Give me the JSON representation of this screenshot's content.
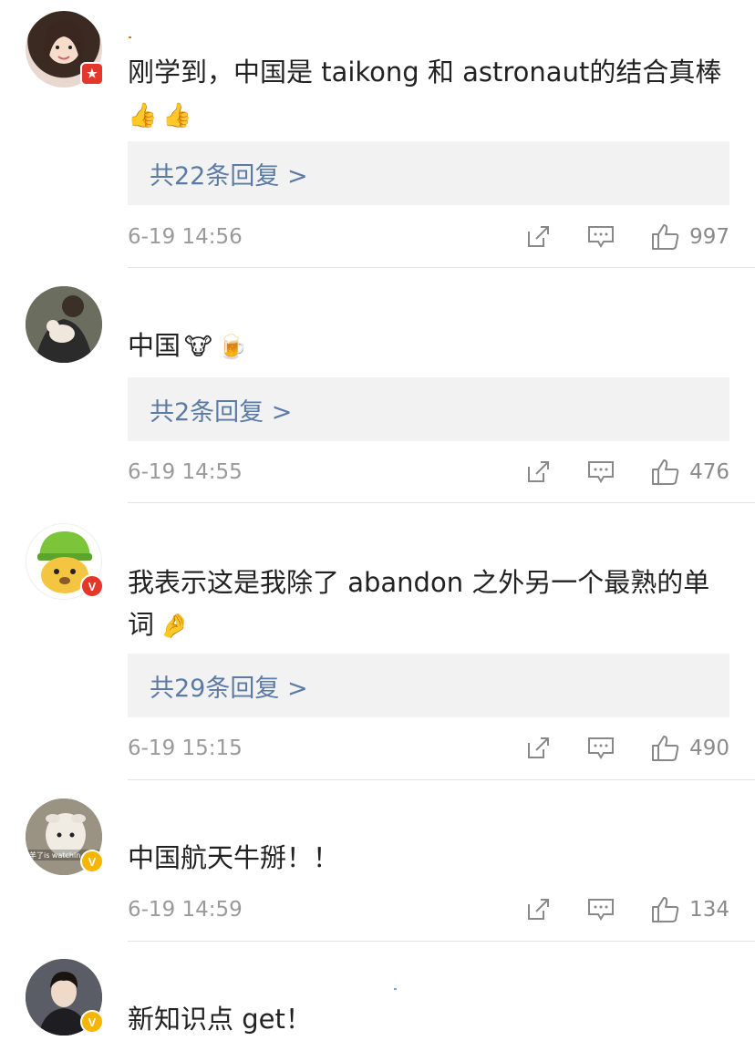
{
  "comments": [
    {
      "text": "刚学到，中国是 taikong 和 astronaut的结合真棒",
      "emojis": [
        "👍",
        "👍"
      ],
      "replies": "共22条回复 >",
      "time": "6-19 14:56",
      "likes": "997",
      "avatar_icon": "woman-portrait-avatar",
      "badge": "flag"
    },
    {
      "text": "中国",
      "emojis": [
        "🐮",
        "🍺"
      ],
      "replies": "共2条回复 >",
      "time": "6-19 14:55",
      "likes": "476",
      "avatar_icon": "person-holding-dog-avatar",
      "badge": ""
    },
    {
      "text": "我表示这是我除了 abandon 之外另一个最熟的单词",
      "emojis": [
        "🤌"
      ],
      "replies": "共29条回复 >",
      "time": "6-19 15:15",
      "likes": "490",
      "avatar_icon": "cartoon-dog-hat-avatar",
      "badge": "V"
    },
    {
      "text": "中国航天牛掰！！",
      "emojis": [],
      "replies": "",
      "time": "6-19 14:59",
      "likes": "134",
      "avatar_icon": "sheep-avatar",
      "badge": "V",
      "avatar_caption": "羊了is watchin"
    },
    {
      "text": "新知识点 get！",
      "emojis": [],
      "replies": "",
      "time": "",
      "likes": "",
      "avatar_icon": "man-in-suit-avatar",
      "badge": "V"
    }
  ],
  "colors": {
    "reply_link": "#5b7aa6",
    "meta_gray": "#9a9a9a",
    "badge_gold": "#f7b500",
    "badge_red": "#e5362b"
  }
}
